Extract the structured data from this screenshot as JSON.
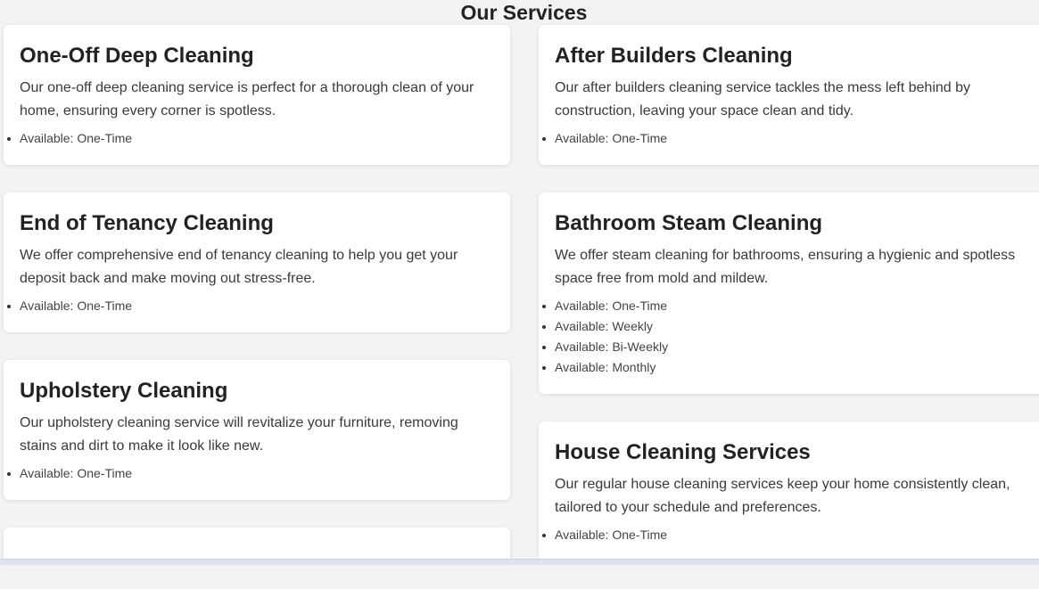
{
  "section": {
    "title": "Our Services"
  },
  "services_left": [
    {
      "title": "One-Off Deep Cleaning",
      "description": "Our one-off deep cleaning service is perfect for a thorough clean of your home, ensuring every corner is spotless.",
      "availability": [
        "Available: One-Time"
      ]
    },
    {
      "title": "End of Tenancy Cleaning",
      "description": "We offer comprehensive end of tenancy cleaning to help you get your deposit back and make moving out stress-free.",
      "availability": [
        "Available: One-Time"
      ]
    },
    {
      "title": "Upholstery Cleaning",
      "description": "Our upholstery cleaning service will revitalize your furniture, removing stains and dirt to make it look like new.",
      "availability": [
        "Available: One-Time"
      ]
    }
  ],
  "services_right": [
    {
      "title": "After Builders Cleaning",
      "description": "Our after builders cleaning service tackles the mess left behind by construction, leaving your space clean and tidy.",
      "availability": [
        "Available: One-Time"
      ]
    },
    {
      "title": "Bathroom Steam Cleaning",
      "description": "We offer steam cleaning for bathrooms, ensuring a hygienic and spotless space free from mold and mildew.",
      "availability": [
        "Available: One-Time",
        "Available: Weekly",
        "Available: Bi-Weekly",
        "Available: Monthly"
      ]
    },
    {
      "title": "House Cleaning Services",
      "description": "Our regular house cleaning services keep your home consistently clean, tailored to your schedule and preferences.",
      "availability": [
        "Available: One-Time"
      ]
    }
  ]
}
